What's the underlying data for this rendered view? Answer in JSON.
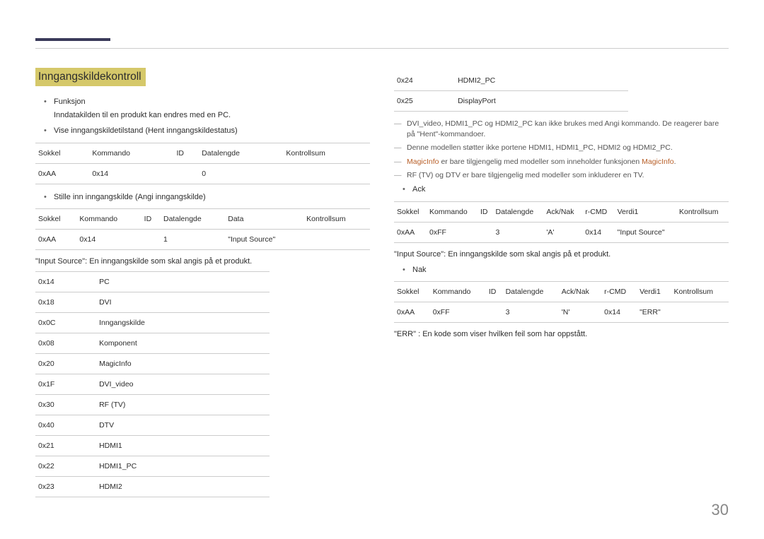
{
  "page_number": "30",
  "left": {
    "title": "Inngangskildekontroll",
    "b1_head": "Funksjon",
    "b1_sub": "Inndatakilden til en produkt kan endres med en PC.",
    "b2": "Vise inngangskildetilstand (Hent inngangskildestatus)",
    "tbl1": {
      "h": [
        "Sokkel",
        "Kommando",
        "ID",
        "Datalengde",
        "Kontrollsum"
      ],
      "r": [
        "0xAA",
        "0x14",
        "",
        "0",
        ""
      ]
    },
    "b3": "Stille inn inngangskilde (Angi inngangskilde)",
    "tbl2": {
      "h": [
        "Sokkel",
        "Kommando",
        "ID",
        "Datalengde",
        "Data",
        "Kontrollsum"
      ],
      "r": [
        "0xAA",
        "0x14",
        "",
        "1",
        "\"Input Source\"",
        ""
      ]
    },
    "desc1": "\"Input Source\": En inngangskilde som skal angis på et produkt.",
    "codes": [
      {
        "c": "0x14",
        "v": "PC"
      },
      {
        "c": "0x18",
        "v": "DVI"
      },
      {
        "c": "0x0C",
        "v": "Inngangskilde"
      },
      {
        "c": "0x08",
        "v": "Komponent"
      },
      {
        "c": "0x20",
        "v": "MagicInfo"
      },
      {
        "c": "0x1F",
        "v": "DVI_video"
      },
      {
        "c": "0x30",
        "v": "RF (TV)"
      },
      {
        "c": "0x40",
        "v": "DTV"
      },
      {
        "c": "0x21",
        "v": "HDMI1"
      },
      {
        "c": "0x22",
        "v": "HDMI1_PC"
      },
      {
        "c": "0x23",
        "v": "HDMI2"
      }
    ]
  },
  "right": {
    "codes_cont": [
      {
        "c": "0x24",
        "v": "HDMI2_PC"
      },
      {
        "c": "0x25",
        "v": "DisplayPort"
      }
    ],
    "n1": "DVI_video, HDMI1_PC og HDMI2_PC kan ikke brukes med Angi kommando. De reagerer bare på \"Hent\"-kommandoer.",
    "n2": "Denne modellen støtter ikke portene HDMI1, HDMI1_PC, HDMI2 og HDMI2_PC.",
    "n3_pre": "MagicInfo",
    "n3_mid": " er bare tilgjengelig med modeller som inneholder funksjonen ",
    "n3_post": "MagicInfo",
    "n3_end": ".",
    "n4": "RF (TV) og DTV er bare tilgjengelig med modeller som inkluderer en TV.",
    "b_ack": "Ack",
    "tbl_ack": {
      "h": [
        "Sokkel",
        "Kommando",
        "ID",
        "Datalengde",
        "Ack/Nak",
        "r-CMD",
        "Verdi1",
        "Kontrollsum"
      ],
      "r": [
        "0xAA",
        "0xFF",
        "",
        "3",
        "'A'",
        "0x14",
        "\"Input Source\"",
        ""
      ]
    },
    "desc2": "\"Input Source\": En inngangskilde som skal angis på et produkt.",
    "b_nak": "Nak",
    "tbl_nak": {
      "h": [
        "Sokkel",
        "Kommando",
        "ID",
        "Datalengde",
        "Ack/Nak",
        "r-CMD",
        "Verdi1",
        "Kontrollsum"
      ],
      "r": [
        "0xAA",
        "0xFF",
        "",
        "3",
        "'N'",
        "0x14",
        "\"ERR\"",
        ""
      ]
    },
    "err": "\"ERR\" : En kode som viser hvilken feil som har oppstått."
  }
}
